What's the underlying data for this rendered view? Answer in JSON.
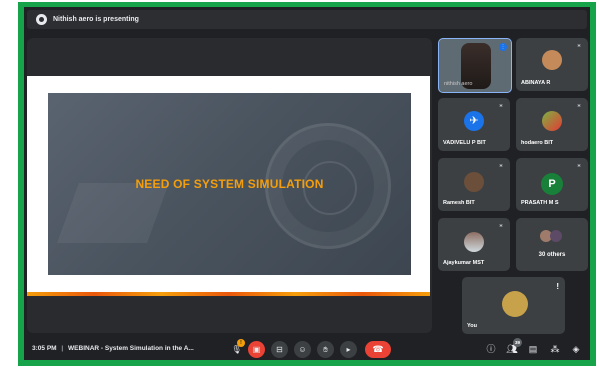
{
  "banner": {
    "text": "Nithish aero is presenting"
  },
  "slide": {
    "title": "NEED OF SYSTEM SIMULATION"
  },
  "participants": [
    {
      "name": "nithish aero",
      "muted": false
    },
    {
      "name": "ABINAYA R",
      "muted": true
    },
    {
      "name": "VADIVELU P BIT",
      "muted": true
    },
    {
      "name": "hodaero BIT",
      "muted": true
    },
    {
      "name": "Ramesh BIT",
      "muted": true
    },
    {
      "name": "PRASATH M S",
      "muted": true,
      "initial": "P"
    },
    {
      "name": "Ajaykumar MST",
      "muted": true
    },
    {
      "name": "30 others"
    }
  ],
  "self_tile": {
    "name": "You"
  },
  "bottombar": {
    "time": "3:05 PM",
    "separator": "|",
    "meeting_title": "WEBINAR - System Simulation in the A...",
    "people_count": "39",
    "mic_badge": "!"
  },
  "colors": {
    "accent_green": "#16a34a",
    "slide_title": "#f59e0b",
    "end_call": "#ea4335",
    "prasath_avatar": "#188038"
  }
}
